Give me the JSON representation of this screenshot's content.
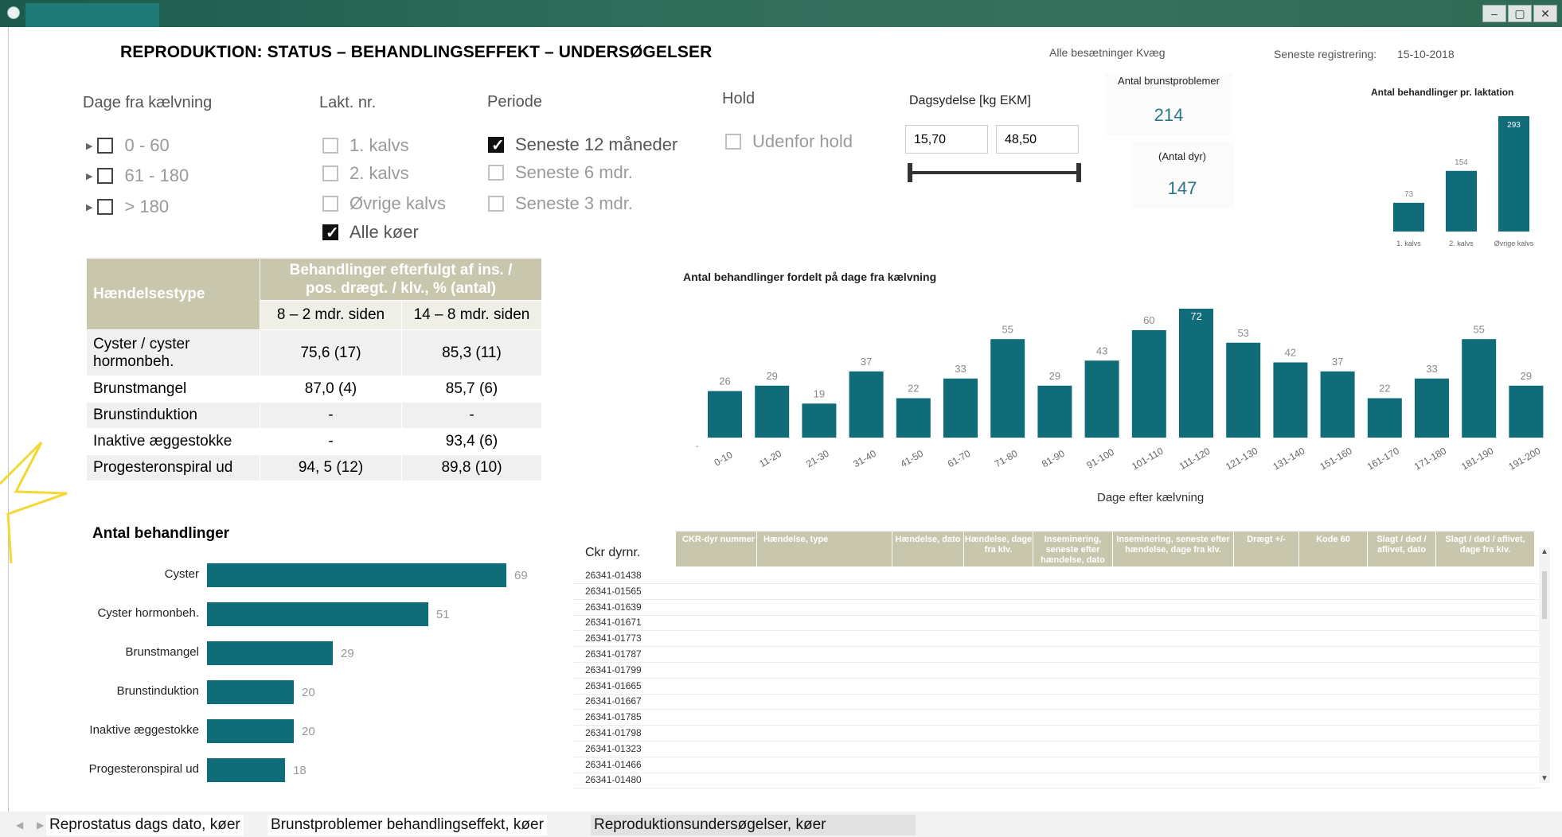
{
  "window": {
    "controls": [
      "–",
      "▢",
      "✕"
    ]
  },
  "header": {
    "title": "REPRODUKTION: STATUS – BEHANDLINGSEFFEKT – UNDERSØGELSER",
    "herd": "Alle besætninger Kvæg",
    "last_reg_label": "Seneste registrering:",
    "last_reg_value": "15-10-2018"
  },
  "filters": {
    "dage": {
      "label": "Dage fra kælvning",
      "options": [
        "0 - 60",
        "61 - 180",
        "> 180"
      ]
    },
    "lakt": {
      "label": "Lakt. nr.",
      "options": [
        "1. kalvs",
        "2. kalvs",
        "Øvrige kalvs",
        "Alle køer"
      ],
      "checked": "Alle køer"
    },
    "periode": {
      "label": "Periode",
      "options": [
        "Seneste 12 måneder",
        "Seneste 6 mdr.",
        "Seneste 3 mdr."
      ],
      "checked": "Seneste 12 måneder"
    },
    "hold": {
      "label": "Hold",
      "options": [
        "Udenfor hold"
      ]
    },
    "dagsydelse": {
      "label": "Dagsydelse [kg EKM]",
      "min": "15,70",
      "max": "48,50"
    }
  },
  "kpis": {
    "brunst_label": "Antal brunstproblemer",
    "brunst_value": "214",
    "dyr_label": "(Antal dyr)",
    "dyr_value": "147"
  },
  "effect_table": {
    "col_event": "Hændelsestype",
    "col_group": "Behandlinger efterfulgt af ins. / pos. drægt. / klv., % (antal)",
    "col_a": "8 – 2 mdr. siden",
    "col_b": "14 – 8 mdr. siden",
    "rows": [
      {
        "name": "Cyster / cyster hormonbeh.",
        "a": "75,6  (17)",
        "b": "85,3 (11)"
      },
      {
        "name": "Brunstmangel",
        "a": "87,0 (4)",
        "b": "85,7 (6)"
      },
      {
        "name": "Brunstinduktion",
        "a": "-",
        "b": "-"
      },
      {
        "name": "Inaktive æggestokke",
        "a": "-",
        "b": "93,4 (6)"
      },
      {
        "name": "Progesteronspiral ud",
        "a": "94, 5 (12)",
        "b": "89,8 (10)"
      }
    ]
  },
  "chart_data": [
    {
      "type": "bar",
      "orientation": "horizontal",
      "title": "Antal behandlinger",
      "categories": [
        "Cyster",
        "Cyster hormonbeh.",
        "Brunstmangel",
        "Brunstinduktion",
        "Inaktive æggestokke",
        "Progesteronspiral ud"
      ],
      "values": [
        69,
        51,
        29,
        20,
        20,
        18
      ],
      "color": "#0f6c78"
    },
    {
      "type": "bar",
      "title": "Antal behandlinger fordelt på dage fra kælvning",
      "xlabel": "Dage efter kælvning",
      "categories": [
        "0-10",
        "11-20",
        "21-30",
        "31-40",
        "41-50",
        "61-70",
        "71-80",
        "81-90",
        "91-100",
        "101-110",
        "111-120",
        "121-130",
        "131-140",
        "151-160",
        "161-170",
        "171-180",
        "181-190",
        "191-200"
      ],
      "values": [
        26,
        29,
        19,
        37,
        22,
        33,
        55,
        29,
        43,
        60,
        72,
        53,
        42,
        37,
        22,
        33,
        55,
        29
      ],
      "color": "#0f6c78"
    },
    {
      "type": "bar",
      "title": "Antal behandlinger pr. laktation",
      "categories": [
        "1. kalvs",
        "2. kalvs",
        "Øvrige kalvs"
      ],
      "values": [
        73,
        154,
        293
      ],
      "color": "#0f6c78"
    }
  ],
  "grid": {
    "row_header": "Ckr dyrnr.",
    "columns": [
      "CKR-dyr nummer",
      "Hændelse, type",
      "Hændelse, dato",
      "Hændelse, dage fra klv.",
      "Insemi­nering, seneste efter hændelse, dato",
      "Insemi­nering, seneste efter hændelse, dage fra klv.",
      "Drægt +/-",
      "Kode 60",
      "Slagt / død / aflivet, dato",
      "Slagt / død / aflivet, dage fra klv."
    ],
    "rows": [
      "26341-01438",
      "26341-01565",
      "26341-01639",
      "26341-01671",
      "26341-01773",
      "26341-01787",
      "26341-01799",
      "26341-01665",
      "26341-01667",
      "26341-01785",
      "26341-01798",
      "26341-01323",
      "26341-01466",
      "26341-01480"
    ]
  },
  "tabs": [
    "Reprostatus dags dato, køer",
    "Brunstproblemer behandlingseffekt, køer",
    "Reproduktionsundersøgelser, køer"
  ]
}
